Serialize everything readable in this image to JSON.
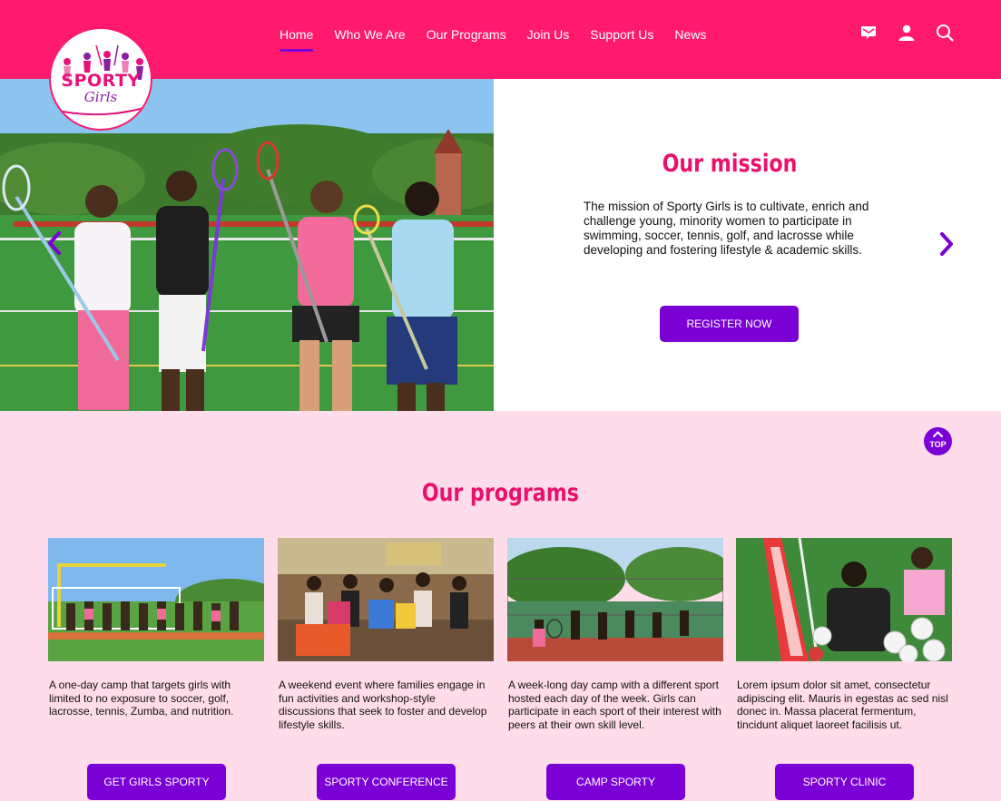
{
  "brand": {
    "logo_line1": "SPORTY",
    "logo_line2": "Girls",
    "primary": "#ff1a6e",
    "accent": "#7a00d6",
    "programs_bg": "#ffdcea"
  },
  "nav": {
    "items": [
      {
        "label": "Home",
        "active": true
      },
      {
        "label": "Who We Are"
      },
      {
        "label": "Our Programs"
      },
      {
        "label": "Join Us"
      },
      {
        "label": "Support Us"
      },
      {
        "label": "News"
      }
    ],
    "icons": [
      "mail-icon",
      "user-icon",
      "search-icon"
    ]
  },
  "hero": {
    "title": "Our mission",
    "text": "The mission of Sporty Girls is to cultivate, enrich and challenge young, minority women to participate in swimming, soccer, tennis, golf, and lacrosse while developing and fostering lifestyle & academic skills.",
    "button": "REGISTER NOW",
    "prev_icon": "chevron-left-icon",
    "next_icon": "chevron-right-icon"
  },
  "top_button": {
    "label": "TOP"
  },
  "programs": {
    "title": "Our programs",
    "cards": [
      {
        "text": "A one-day camp that targets girls with limited to no exposure to soccer, golf, lacrosse, tennis, Zumba, and nutrition.",
        "button": "GET GIRLS SPORTY"
      },
      {
        "text": "A weekend event where families engage in fun activities and workshop-style discussions that seek to foster and develop lifestyle skills.",
        "button": "SPORTY CONFERENCE"
      },
      {
        "text": "A week-long day camp with a different sport hosted each day of the week. Girls can participate in each sport of their interest with peers at their own skill level.",
        "button": "CAMP SPORTY"
      },
      {
        "text": "Lorem ipsum dolor sit amet, consectetur adipiscing elit. Mauris in egestas ac sed nisl donec in. Massa placerat fermentum, tincidunt aliquet laoreet facilisis ut.",
        "button": "SPORTY CLINIC"
      }
    ]
  }
}
